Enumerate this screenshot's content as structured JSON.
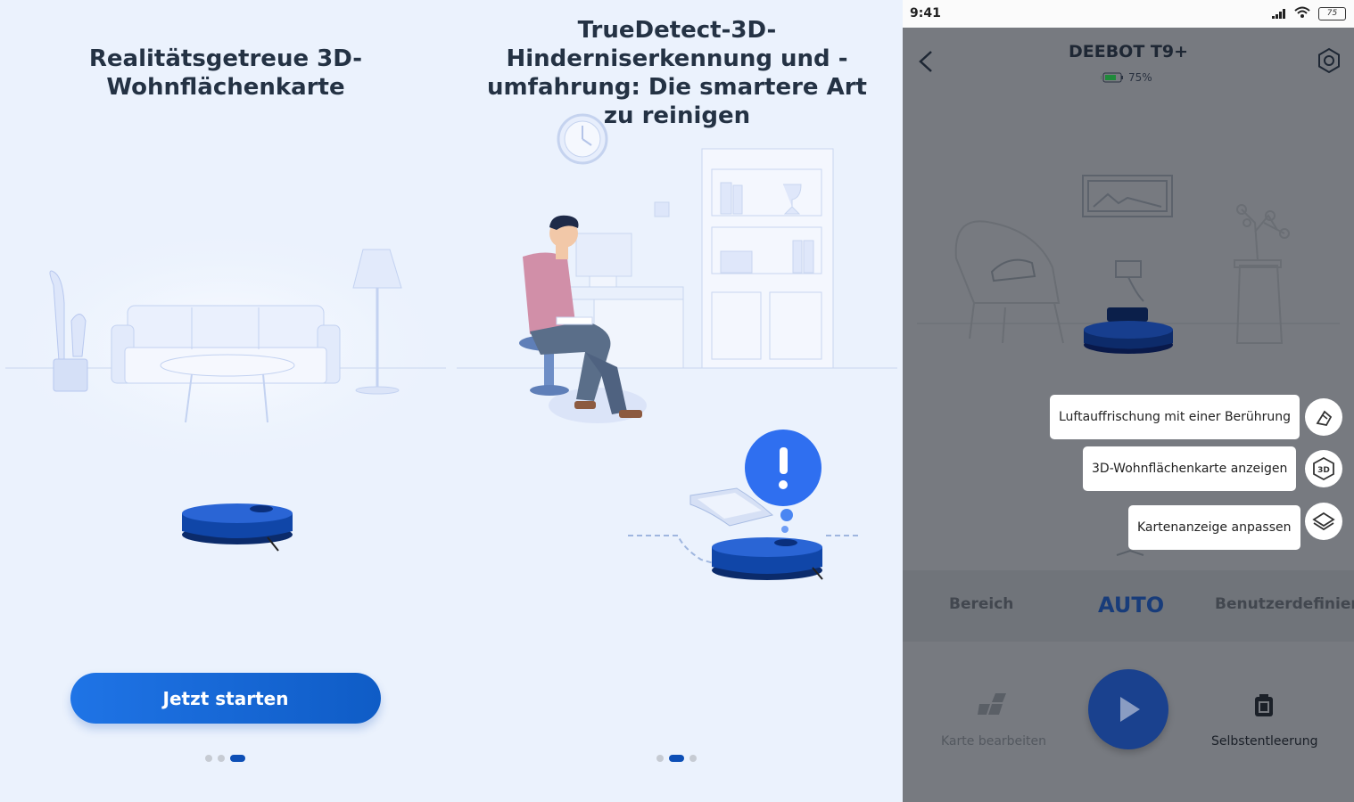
{
  "panel1": {
    "title": "Realitätsgetreue 3D-Wohnflächenkarte",
    "start_button": "Jetzt starten",
    "pager": {
      "total": 3,
      "active": 3
    }
  },
  "panel2": {
    "title": "TrueDetect-3D-Hinderniserkennung und -umfahrung: Die smartere Art zu reinigen",
    "pager": {
      "total": 3,
      "active": 2
    }
  },
  "phone": {
    "status": {
      "time": "9:41",
      "battery": "75"
    },
    "device": {
      "name": "DEEBOT T9+",
      "battery": "75%"
    },
    "menu": [
      {
        "label": "Luftauffrischung mit einer Berührung",
        "icon": "air-freshener-icon"
      },
      {
        "label": "3D-Wohnflächenkarte anzeigen",
        "icon": "3d-map-icon"
      },
      {
        "label": "Kartenanzeige anpassen",
        "icon": "layers-icon"
      }
    ],
    "modes": [
      "Bereich",
      "AUTO",
      "Benutzerdefiniert"
    ],
    "active_mode": "AUTO",
    "bottom": {
      "edit_map": "Karte bearbeiten",
      "self_empty": "Selbstentleerung"
    }
  },
  "colors": {
    "accent": "#1f74e6",
    "robot": "#0d3f9b",
    "overlay": "#777a80",
    "background": "#ebf2fd"
  }
}
